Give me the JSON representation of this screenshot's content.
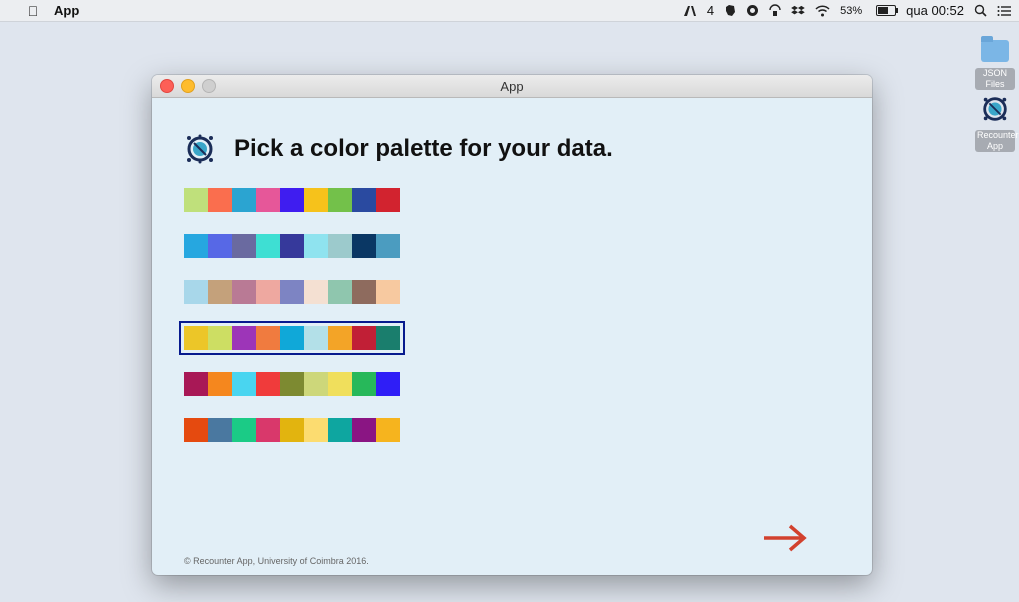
{
  "menubar": {
    "app_name": "App",
    "items": [
      "4",
      "53%",
      "qua 00:52"
    ],
    "battery_percent": 53
  },
  "desktop": {
    "icons": [
      {
        "label": "JSON Files",
        "type": "folder-icon"
      },
      {
        "label": "Recounter App",
        "type": "app-icon"
      }
    ]
  },
  "window": {
    "title": "App",
    "heading": "Pick a color palette for your data.",
    "footer": "© Recounter App, University of Coimbra 2016.",
    "selected_palette": 3,
    "palettes": [
      [
        "#bfe07b",
        "#fa6e4e",
        "#2ba4d1",
        "#e65799",
        "#3f1df0",
        "#f6c21b",
        "#73c14a",
        "#2a4aa0",
        "#d2232f"
      ],
      [
        "#26a7e0",
        "#5768e6",
        "#6a6aa0",
        "#3edfd3",
        "#36399b",
        "#8fe3ef",
        "#9ccacc",
        "#0a3764",
        "#4b9cc0"
      ],
      [
        "#a8d7ea",
        "#c4a17b",
        "#b97a95",
        "#eea8a0",
        "#7d84c3",
        "#f4e0d2",
        "#8fc6ae",
        "#8e6b5e",
        "#f7c9a0"
      ],
      [
        "#ecc628",
        "#cdde63",
        "#9d35b8",
        "#f07b3f",
        "#10a8d8",
        "#b3e0e8",
        "#f3a427",
        "#c11f36",
        "#1a7e6d"
      ],
      [
        "#a81856",
        "#f5871e",
        "#49d5f0",
        "#f03b3b",
        "#7d8a31",
        "#cdd77a",
        "#f0df5c",
        "#27b85a",
        "#2f1ef7"
      ],
      [
        "#e54a0f",
        "#4a78a0",
        "#1bcb86",
        "#d9386b",
        "#e2b40f",
        "#fcdc70",
        "#0ea6a0",
        "#8a1583",
        "#f6b41e"
      ]
    ]
  },
  "colors": {
    "selection_outline": "#071a8e",
    "arrow": "#d2412e"
  }
}
